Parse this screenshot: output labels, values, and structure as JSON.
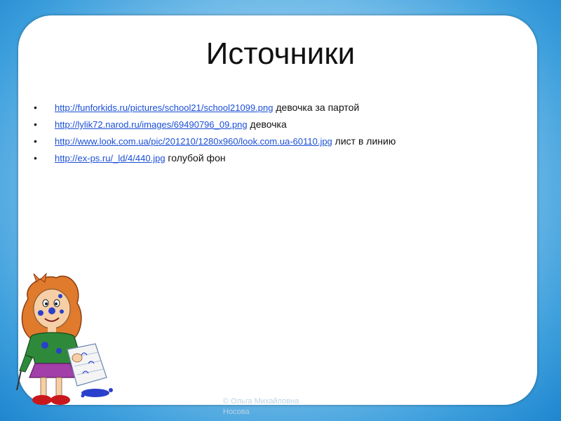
{
  "title": "Источники",
  "sources": [
    {
      "url": "http://funforkids.ru/pictures/school21/school21099.png",
      "desc": " девочка за партой"
    },
    {
      "url": "http://lylik72.narod.ru/images/69490796_09.png",
      "desc": "  девочка"
    },
    {
      "url": "http://www.look.com.ua/pic/201210/1280x960/look.com.ua-60110.jpg",
      "desc": "  лист в линию"
    },
    {
      "url": "http://ex-ps.ru/_ld/4/440.jpg",
      "desc": " голубой фон"
    }
  ],
  "footer": {
    "line1": "© Ольга Михайловна",
    "line2": "Носова"
  },
  "colors": {
    "link": "#1b4fd6",
    "background": "#3d9fdc",
    "card": "#ffffff"
  },
  "illustration": "girl-with-ink-blots"
}
